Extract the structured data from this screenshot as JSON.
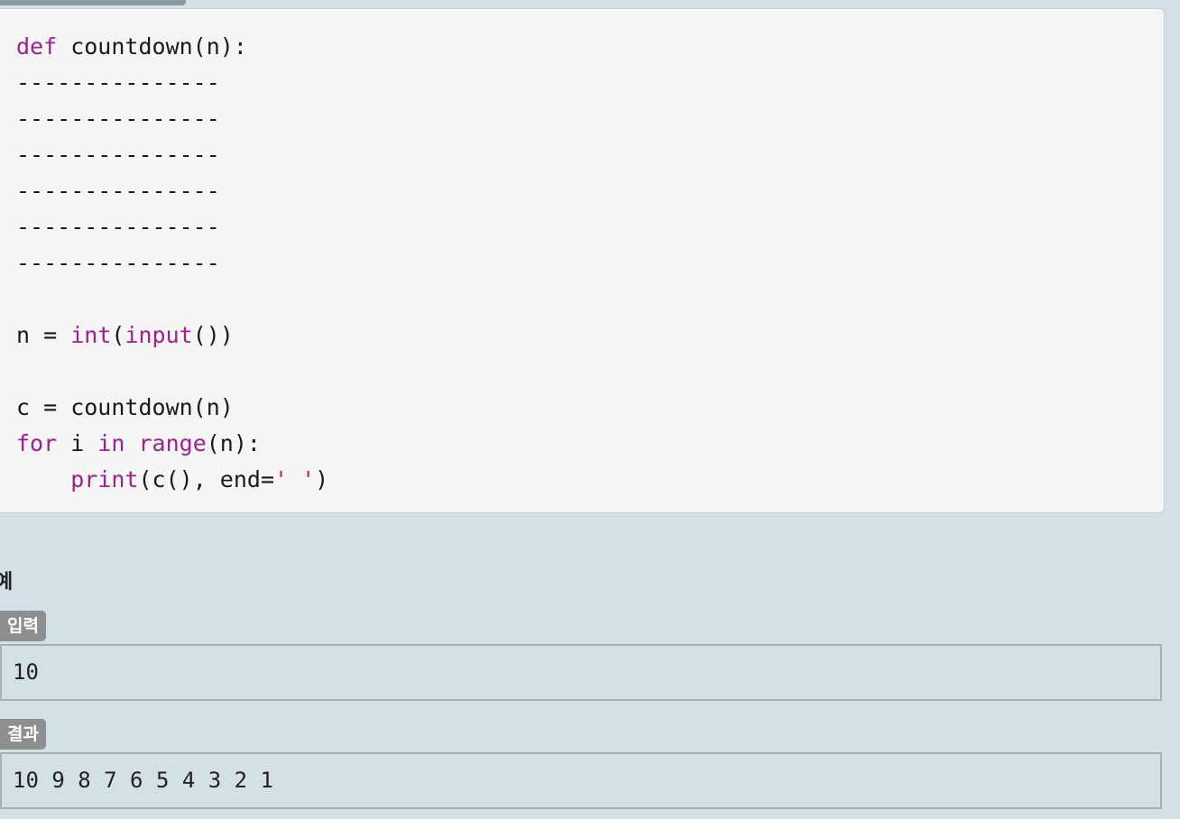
{
  "code": {
    "lines": [
      [
        {
          "t": "def",
          "c": "kw"
        },
        {
          "t": " countdown(n):",
          "c": ""
        }
      ],
      [
        {
          "t": "---------------",
          "c": ""
        }
      ],
      [
        {
          "t": "---------------",
          "c": ""
        }
      ],
      [
        {
          "t": "---------------",
          "c": ""
        }
      ],
      [
        {
          "t": "---------------",
          "c": ""
        }
      ],
      [
        {
          "t": "---------------",
          "c": ""
        }
      ],
      [
        {
          "t": "---------------",
          "c": ""
        }
      ],
      [
        {
          "t": "",
          "c": ""
        }
      ],
      [
        {
          "t": "n = ",
          "c": ""
        },
        {
          "t": "int",
          "c": "kw"
        },
        {
          "t": "(",
          "c": ""
        },
        {
          "t": "input",
          "c": "kw"
        },
        {
          "t": "())",
          "c": ""
        }
      ],
      [
        {
          "t": "",
          "c": ""
        }
      ],
      [
        {
          "t": "c = countdown(n)",
          "c": ""
        }
      ],
      [
        {
          "t": "for",
          "c": "kw"
        },
        {
          "t": " i ",
          "c": ""
        },
        {
          "t": "in",
          "c": "kw"
        },
        {
          "t": " ",
          "c": ""
        },
        {
          "t": "range",
          "c": "kw"
        },
        {
          "t": "(n):",
          "c": ""
        }
      ],
      [
        {
          "t": "    ",
          "c": ""
        },
        {
          "t": "print",
          "c": "kw"
        },
        {
          "t": "(c(), end=",
          "c": ""
        },
        {
          "t": "' '",
          "c": "str"
        },
        {
          "t": ")",
          "c": ""
        }
      ]
    ]
  },
  "example": {
    "heading": "예",
    "input_label": "입력",
    "input_value": "10",
    "output_label": "결과",
    "output_value": "10 9 8 7 6 5 4 3 2 1"
  },
  "colors": {
    "background": "#d3e1e7",
    "code_background": "#f5f5f5",
    "keyword": "#a1208f",
    "string": "#c9262f",
    "badge": "#8e8e8e"
  }
}
